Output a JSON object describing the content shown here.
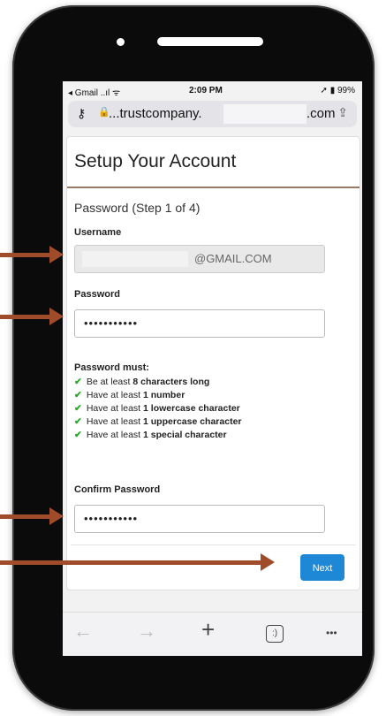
{
  "status_bar": {
    "left": "◂ Gmail ..ıl ᯤ",
    "time": "2:09 PM",
    "right": "➚ ▮ 99%"
  },
  "browser": {
    "url_prefix": "...trustcompany.",
    "url_suffix": ".com"
  },
  "page": {
    "title": "Setup Your Account",
    "step": "Password (Step 1 of 4)",
    "username_label": "Username",
    "username_value": "@GMAIL.COM",
    "password_label": "Password",
    "password_value": "•••••••••••",
    "rules_heading": "Password must:",
    "rules": [
      {
        "pre": "Be at least ",
        "bold": "8 characters long"
      },
      {
        "pre": "Have at least ",
        "bold": "1 number"
      },
      {
        "pre": "Have at least ",
        "bold": "1 lowercase character"
      },
      {
        "pre": "Have at least ",
        "bold": "1 uppercase character"
      },
      {
        "pre": "Have at least ",
        "bold": "1 special character"
      }
    ],
    "confirm_label": "Confirm Password",
    "confirm_value": "•••••••••••",
    "next_label": "Next"
  },
  "toolbar": {
    "back": "←",
    "forward": "→",
    "new_tab": "+",
    "tabs": ":)",
    "more": "•••"
  },
  "colors": {
    "accent": "#1e88d6",
    "arrow": "#a04c2a",
    "check": "#2aa52a"
  }
}
